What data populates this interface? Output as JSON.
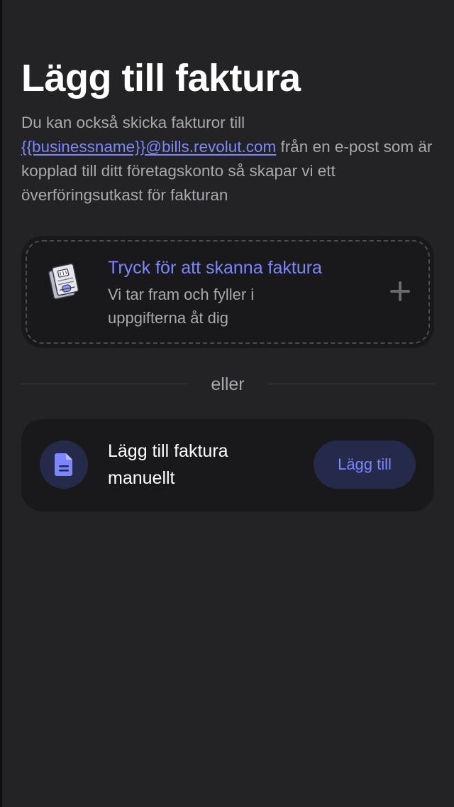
{
  "header": {
    "title": "Lägg till faktura"
  },
  "intro": {
    "text_before": "Du kan också skicka fakturor till ",
    "email_link": "{{businessname}}@bills.revolut.com",
    "text_after": " från en e-post som är kopplad till ditt företagskonto så skapar vi ett överföringsutkast för fakturan"
  },
  "scan_card": {
    "title": "Tryck för att skanna faktura",
    "subtitle": "Vi tar fram och fyller i uppgifterna åt dig",
    "icon": "invoice-scan-icon",
    "action_icon": "plus-icon"
  },
  "divider": {
    "label": "eller"
  },
  "manual_card": {
    "label": "Lägg till faktura manuellt",
    "icon": "document-icon",
    "button_label": "Lägg till"
  },
  "colors": {
    "background": "#232325",
    "card": "#19191b",
    "accent": "#7b86ff",
    "muted_text": "#a8a8ae",
    "badge_bg": "#262a4a"
  }
}
